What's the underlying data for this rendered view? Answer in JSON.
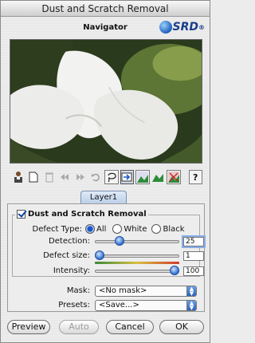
{
  "window": {
    "title": "Dust and Scratch Removal"
  },
  "navigator": {
    "title": "Navigator",
    "logo": "SRD",
    "logo_suffix": "®"
  },
  "toolbar": {
    "icons": [
      "person-icon",
      "new-layer-icon",
      "trash-icon",
      "rewind-icon",
      "fast-forward-icon",
      "undo-icon",
      "lasso-icon",
      "apply-arrow-icon",
      "landscape-tool-1-icon",
      "landscape-tool-2-icon",
      "landscape-tool-3-icon",
      "help-icon"
    ],
    "help_label": "?"
  },
  "tabs": [
    {
      "label": "Layer1",
      "selected": true
    }
  ],
  "filter": {
    "enabled": true,
    "title": "Dust and Scratch Removal",
    "defect_type": {
      "label": "Defect Type:",
      "options": [
        "All",
        "White",
        "Black"
      ],
      "selected": "All"
    },
    "detection": {
      "label": "Detection:",
      "value": "25",
      "level": 0.27
    },
    "defect_size": {
      "label": "Defect size:",
      "value": "1",
      "level": 0.0
    },
    "intensity": {
      "label": "Intensity:",
      "value": "100",
      "level": 1.0
    }
  },
  "mask": {
    "label": "Mask:",
    "value": "<No mask>"
  },
  "presets": {
    "label": "Presets:",
    "value": "<Save...>"
  },
  "buttons": {
    "preview": "Preview",
    "auto": "Auto",
    "cancel": "Cancel",
    "ok": "OK"
  },
  "colors": {
    "accent": "#2f6fd1",
    "tab": "#b9cde8"
  }
}
